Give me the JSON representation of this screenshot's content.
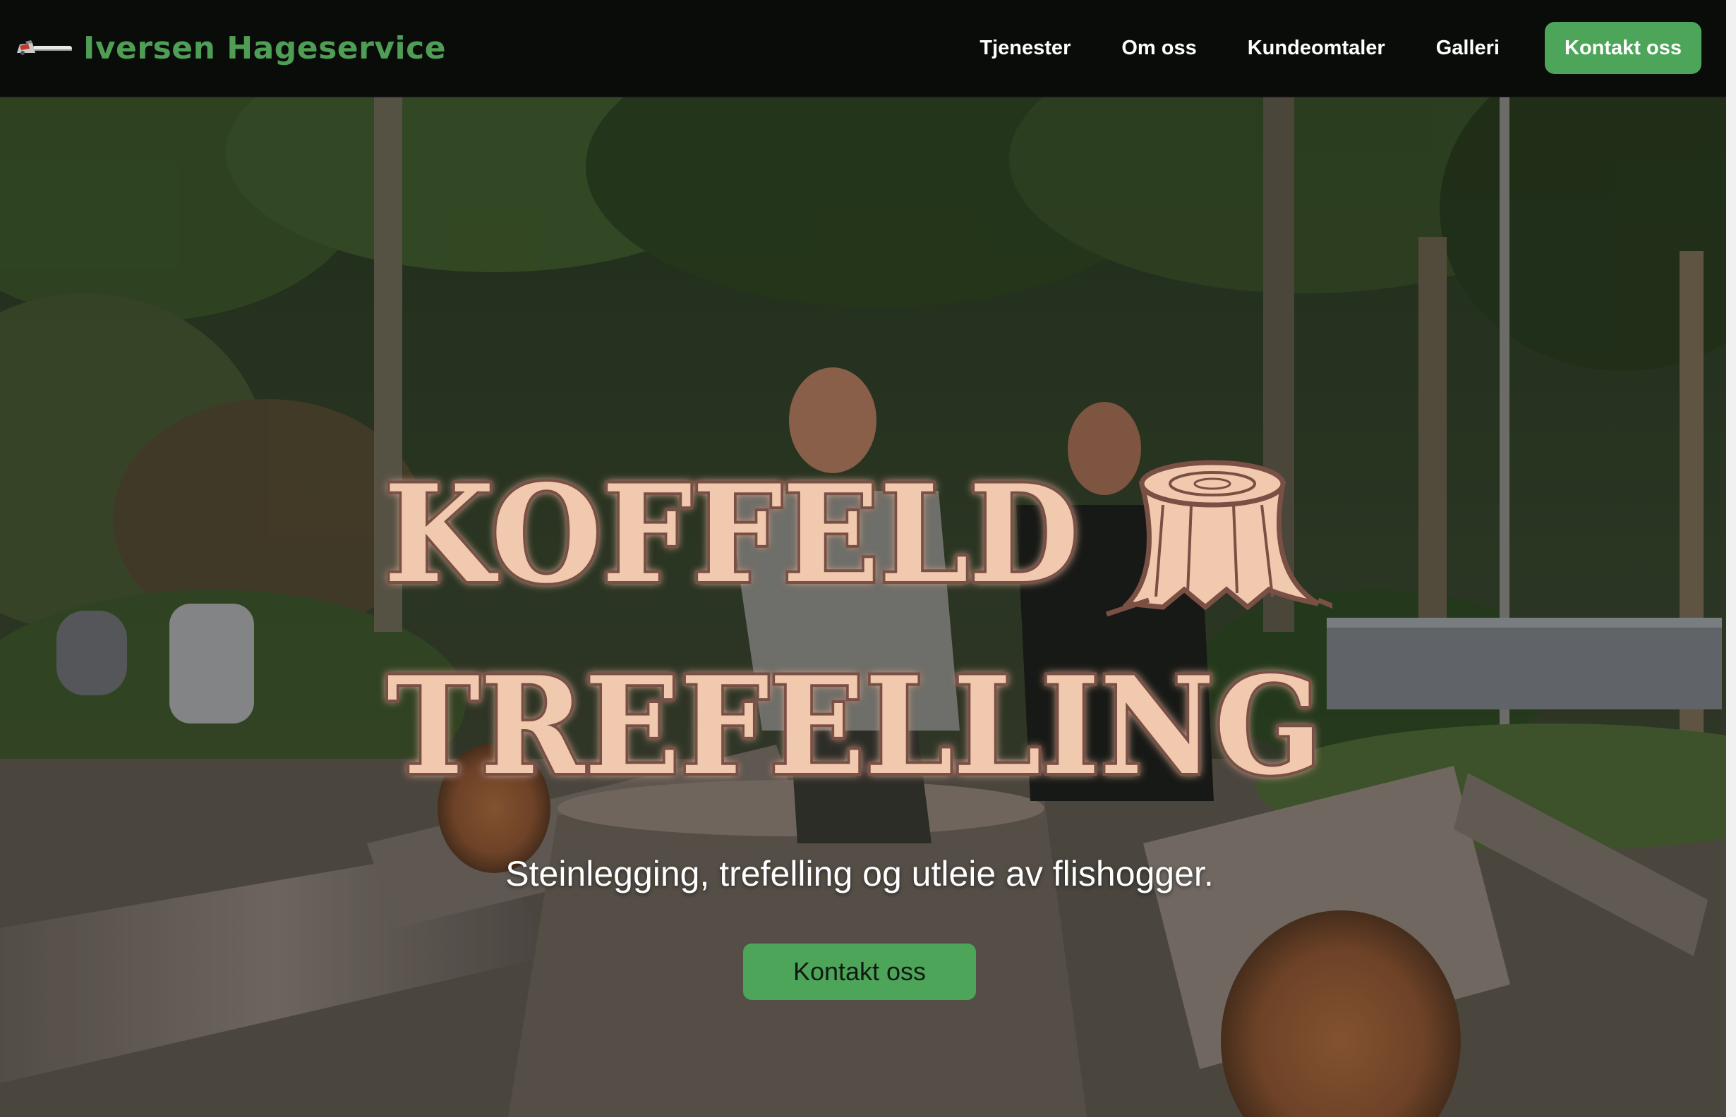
{
  "brand": {
    "name": "Iversen Hageservice",
    "logo_icon": "chainsaw-icon",
    "color": "#4f9e55"
  },
  "nav": {
    "links": [
      {
        "label": "Tjenester"
      },
      {
        "label": "Om oss"
      },
      {
        "label": "Kundeomtaler"
      },
      {
        "label": "Galleri"
      }
    ],
    "cta_label": "Kontakt oss"
  },
  "hero": {
    "logo": {
      "line1": "KOFFELD",
      "line2": "TREFELLING",
      "icon": "tree-stump-icon"
    },
    "tagline": "Steinlegging, trefelling og utleie av flishogger.",
    "cta_label": "Kontakt oss",
    "background": "photo-two-men-felled-logs-forest"
  },
  "colors": {
    "accent": "#4ca559",
    "navbar_bg": "#0a0c0a",
    "logo_fill": "#f0c9ae",
    "logo_outline": "#7a5045"
  }
}
